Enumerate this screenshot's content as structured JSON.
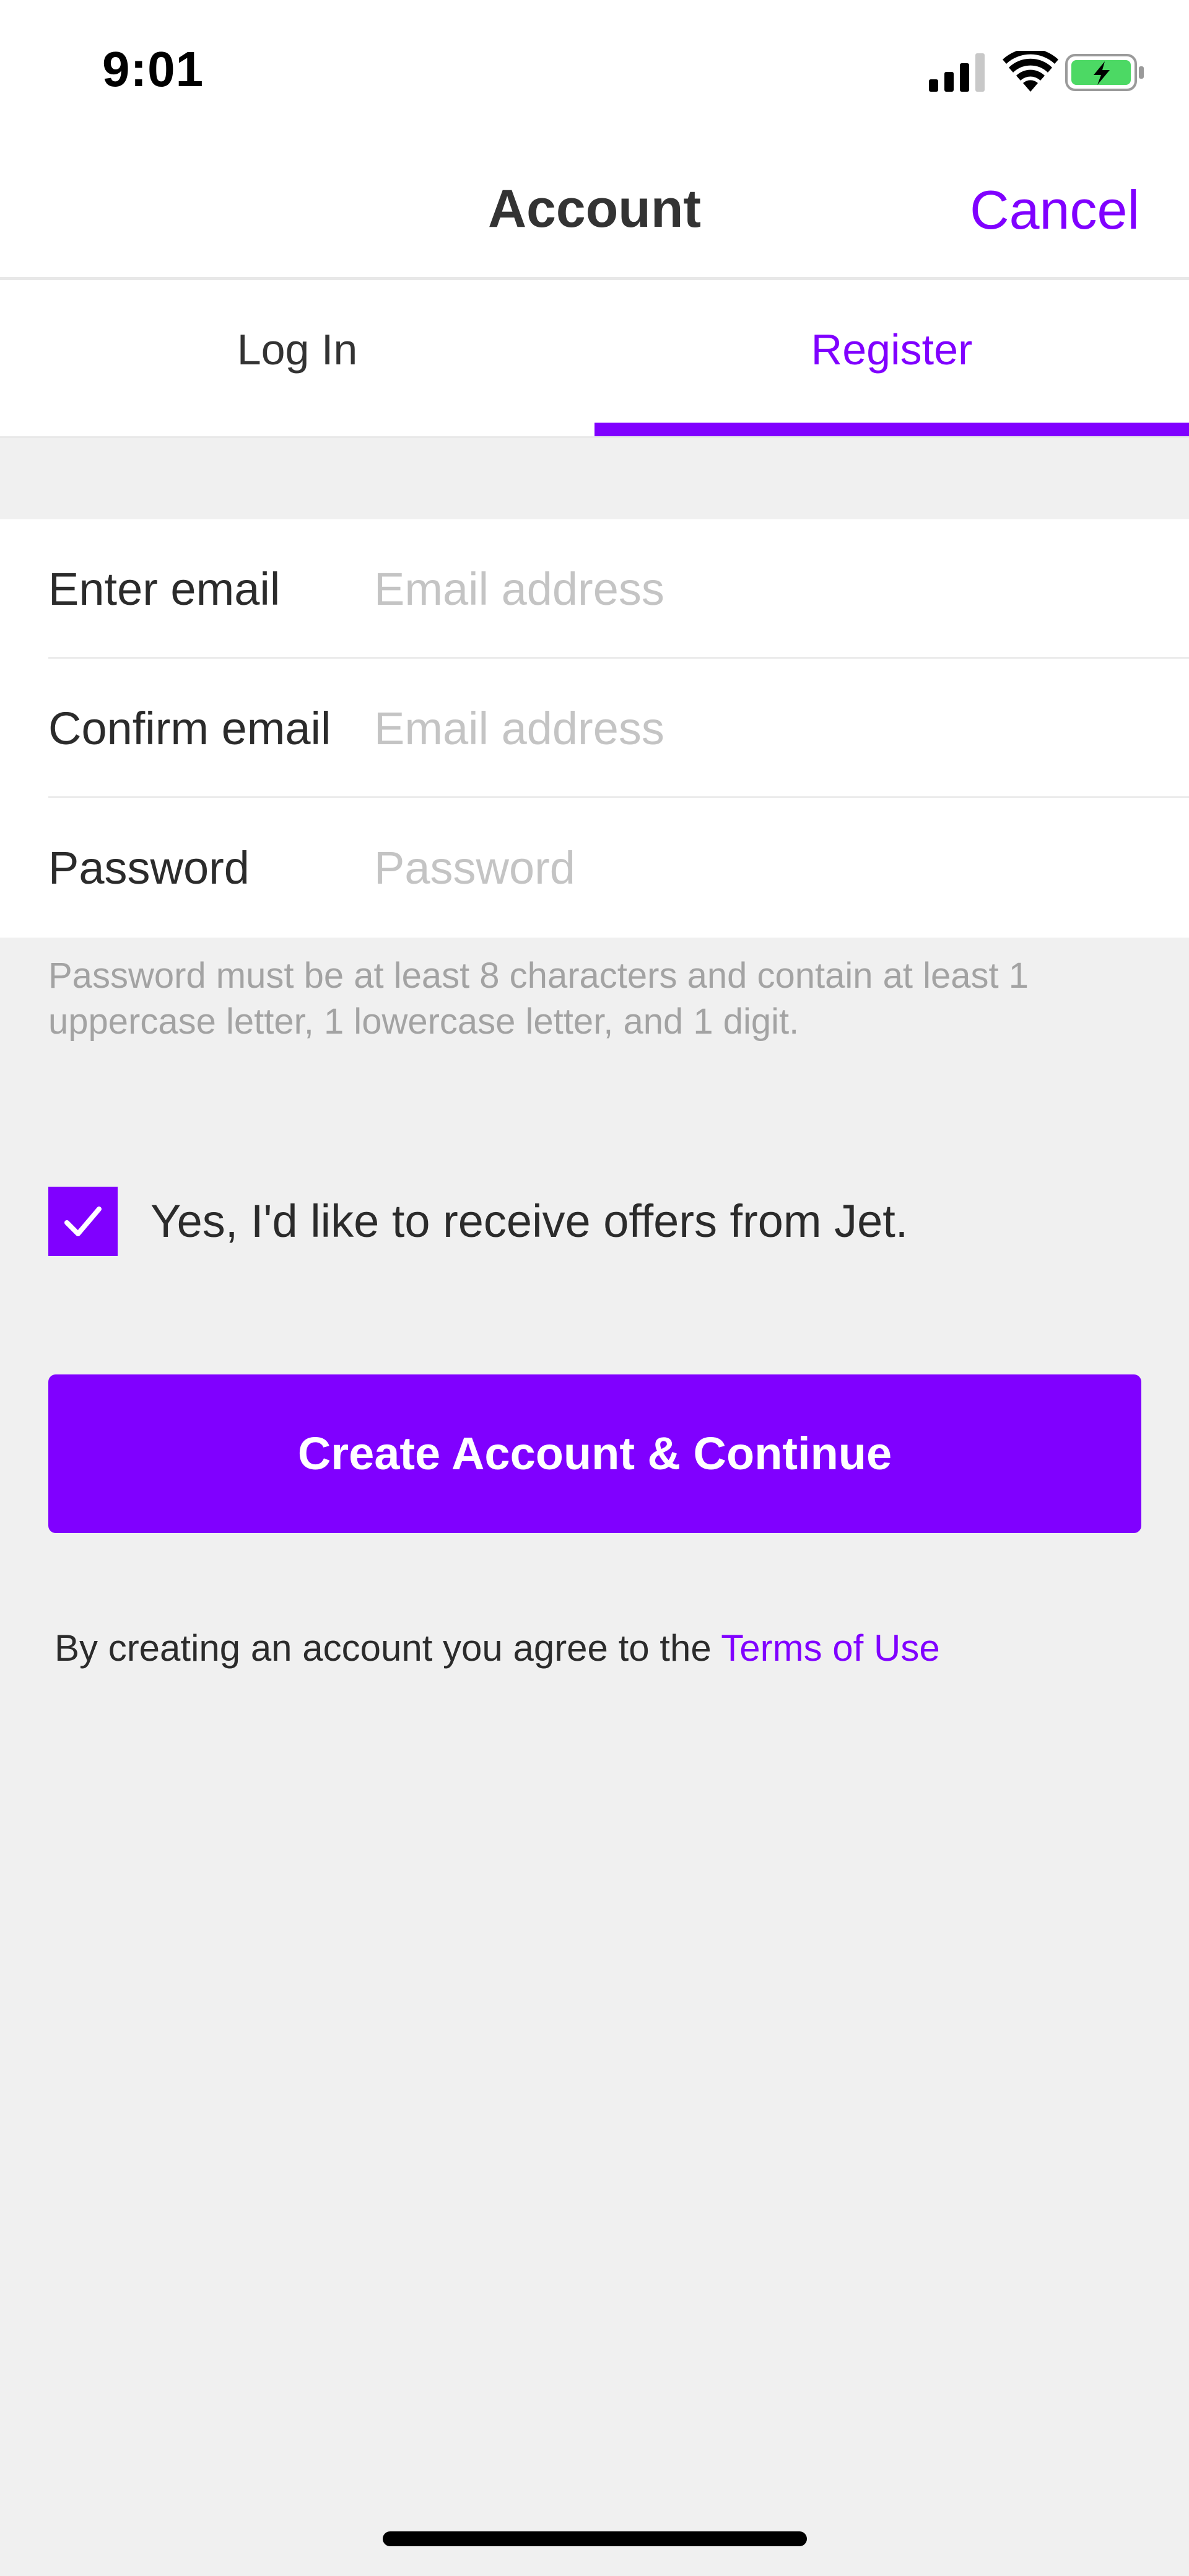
{
  "status_bar": {
    "time": "9:01",
    "icons": [
      "cellular-signal-icon",
      "wifi-icon",
      "battery-charging-icon"
    ],
    "battery_color": "#4cd964"
  },
  "nav": {
    "title": "Account",
    "cancel_label": "Cancel"
  },
  "tabs": [
    {
      "label": "Log In",
      "active": false
    },
    {
      "label": "Register",
      "active": true
    }
  ],
  "form": {
    "rows": [
      {
        "label": "Enter email",
        "placeholder": "Email address",
        "value": ""
      },
      {
        "label": "Confirm email",
        "placeholder": "Email address",
        "value": ""
      },
      {
        "label": "Password",
        "placeholder": "Password",
        "value": ""
      }
    ],
    "password_hint": "Password must be at least 8 characters and contain at least 1 uppercase letter, 1 lowercase letter, and 1 digit."
  },
  "optin": {
    "checked": true,
    "label": "Yes, I'd like to receive offers from Jet.",
    "icon": "checkmark-icon"
  },
  "primary_button_label": "Create Account & Continue",
  "terms": {
    "prefix": "By creating an account you agree to the ",
    "link_label": "Terms of Use"
  },
  "colors": {
    "accent": "#8000ff",
    "background": "#f0f0f0",
    "surface": "#ffffff",
    "placeholder": "#c4c4c4",
    "hint": "#a3a3a3"
  }
}
